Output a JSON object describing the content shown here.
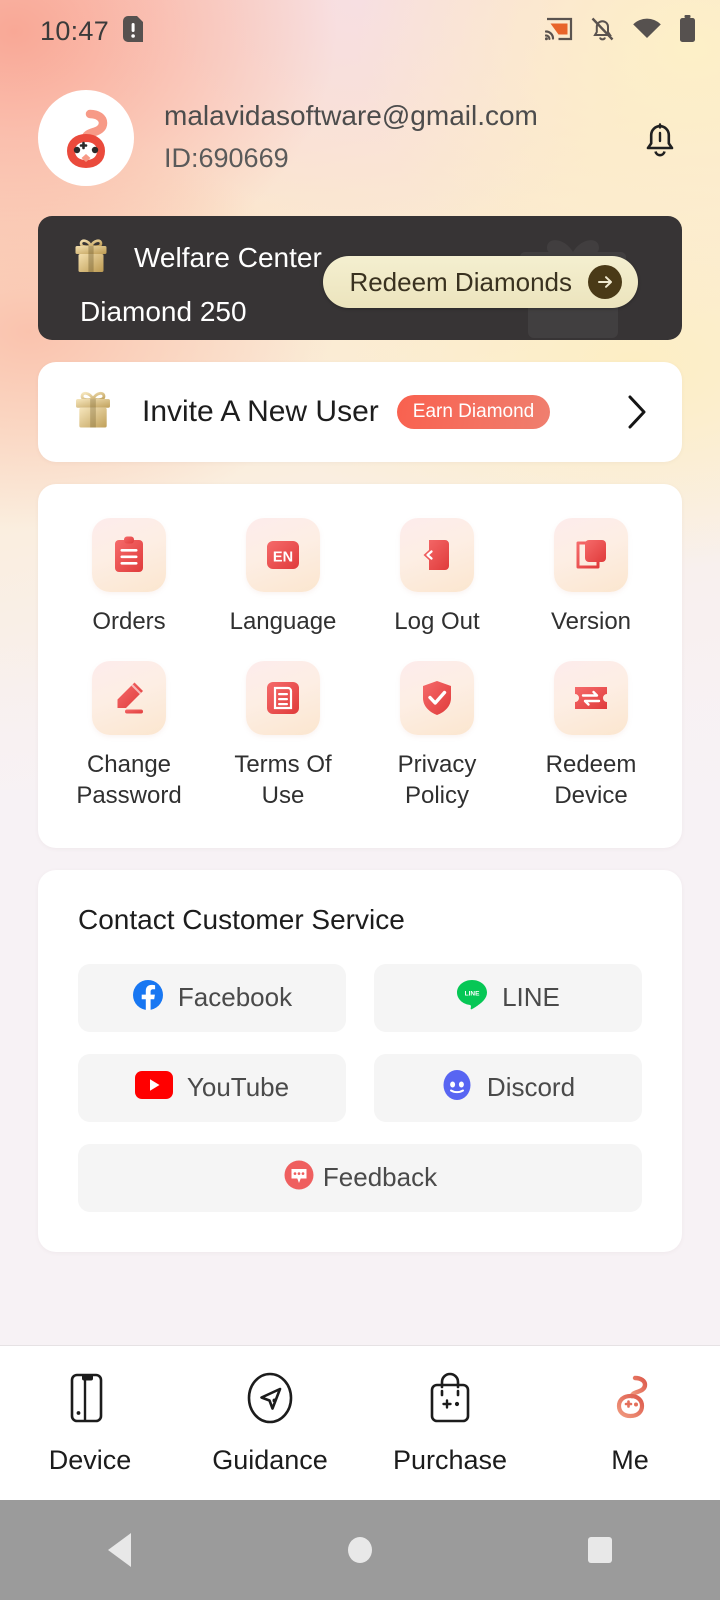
{
  "status_bar": {
    "time": "10:47",
    "icons": [
      "sim-card-alert-icon",
      "cast-icon",
      "notifications-off-icon",
      "wifi-icon",
      "battery-icon"
    ]
  },
  "header": {
    "avatar_name": "user-avatar",
    "email": "malavidasoftware@gmail.com",
    "user_id": "ID:690669",
    "bell_icon": "notification-bell-icon"
  },
  "welfare": {
    "gift_icon": "gift-box-icon",
    "title": "Welfare Center",
    "diamond_text": "Diamond 250",
    "redeem_label": "Redeem Diamonds",
    "redeem_arrow_icon": "arrow-right-circle-icon",
    "bg_color": "#373435",
    "pill_color": "#ece4bd",
    "pill_text_color": "#3a3220"
  },
  "invite": {
    "gift_icon": "gift-box-icon",
    "label": "Invite A New User",
    "badge": "Earn Diamond",
    "badge_color": "#f9614f",
    "chevron_icon": "chevron-right-icon"
  },
  "menu_grid": [
    {
      "label": "Orders",
      "icon": "clipboard-icon"
    },
    {
      "label": "Language",
      "icon": "language-en-icon"
    },
    {
      "label": "Log Out",
      "icon": "logout-icon"
    },
    {
      "label": "Version",
      "icon": "layers-icon"
    },
    {
      "label": "Change Password",
      "icon": "pencil-edit-icon"
    },
    {
      "label": "Terms Of Use",
      "icon": "document-icon"
    },
    {
      "label": "Privacy Policy",
      "icon": "shield-check-icon"
    },
    {
      "label": "Redeem Device",
      "icon": "ticket-swap-icon"
    }
  ],
  "contact": {
    "title": "Contact Customer Service",
    "buttons": [
      {
        "label": "Facebook",
        "icon": "facebook-icon",
        "color": "#1877f2"
      },
      {
        "label": "LINE",
        "icon": "line-icon",
        "color": "#06c755"
      },
      {
        "label": "YouTube",
        "icon": "youtube-icon",
        "color": "#ff0000"
      },
      {
        "label": "Discord",
        "icon": "discord-icon",
        "color": "#5865f2"
      },
      {
        "label": "Feedback",
        "icon": "feedback-chat-icon",
        "color": "#ef5f5f"
      }
    ]
  },
  "tabbar": {
    "active": "Me",
    "active_color": "#e8725f",
    "items": [
      {
        "label": "Device",
        "icon": "device-phone-icon"
      },
      {
        "label": "Guidance",
        "icon": "compass-navigate-icon"
      },
      {
        "label": "Purchase",
        "icon": "shopping-bag-icon"
      },
      {
        "label": "Me",
        "icon": "app-logo-icon"
      }
    ]
  },
  "android_nav": {
    "back_icon": "back-triangle-icon",
    "home_icon": "home-circle-icon",
    "recents_icon": "recents-square-icon"
  }
}
